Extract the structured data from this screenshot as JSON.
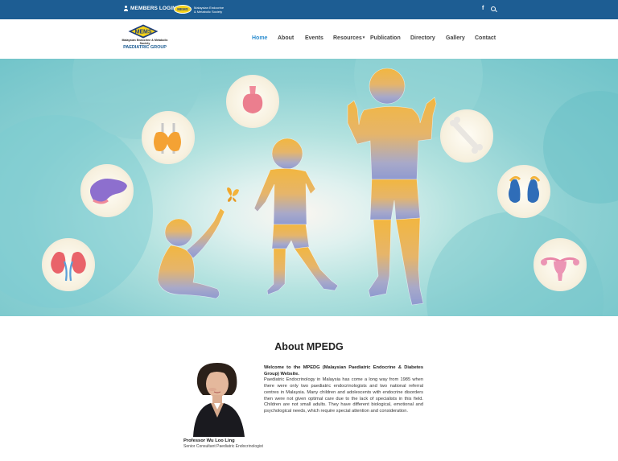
{
  "topbar": {
    "members_label": "MEMBERS LOGIN",
    "badge": "MEMS",
    "badge_name": "Malaysian Endocrine & Metabolic Society",
    "facebook": "f",
    "bg_color": "#1d5d93"
  },
  "logo": {
    "mark": "MEMS",
    "line1": "Malaysian Endocrine & Metabolic Society",
    "line2": "PAEDIATRIC GROUP"
  },
  "nav": {
    "items": [
      {
        "label": "Home",
        "active": true
      },
      {
        "label": "About"
      },
      {
        "label": "Events"
      },
      {
        "label": "Resources",
        "dropdown": true
      },
      {
        "label": "Publication"
      },
      {
        "label": "Directory"
      },
      {
        "label": "Gallery"
      },
      {
        "label": "Contact"
      }
    ],
    "active_color": "#2f8fd0"
  },
  "hero": {
    "icons": [
      "kidney-icon",
      "pancreas-icon",
      "thyroid-icon",
      "pituitary-icon",
      "bone-icon",
      "adrenal-icon",
      "uterus-icon",
      "butterfly-icon"
    ]
  },
  "about": {
    "title": "About MPEDG",
    "lead": "Welcome to the MPEDG (Malaysian Paediatric Endocrine & Diabetes Group) Website.",
    "body": "Paediatric Endocrinology in Malaysia has come a long way from 1985 when there were only two paediatric endocrinologists and two national referral centres in Malaysia. Many children and adolescents with endocrine disorders then were not given optimal care due to the lack of specialists in this field. Children are not small adults. They have different biological, emotional and psychological needs, which require special attention and consideration.",
    "person_name": "Professor Wu Loo Ling",
    "person_role": "Senior Consultant Paediatric Endocrinologist"
  }
}
